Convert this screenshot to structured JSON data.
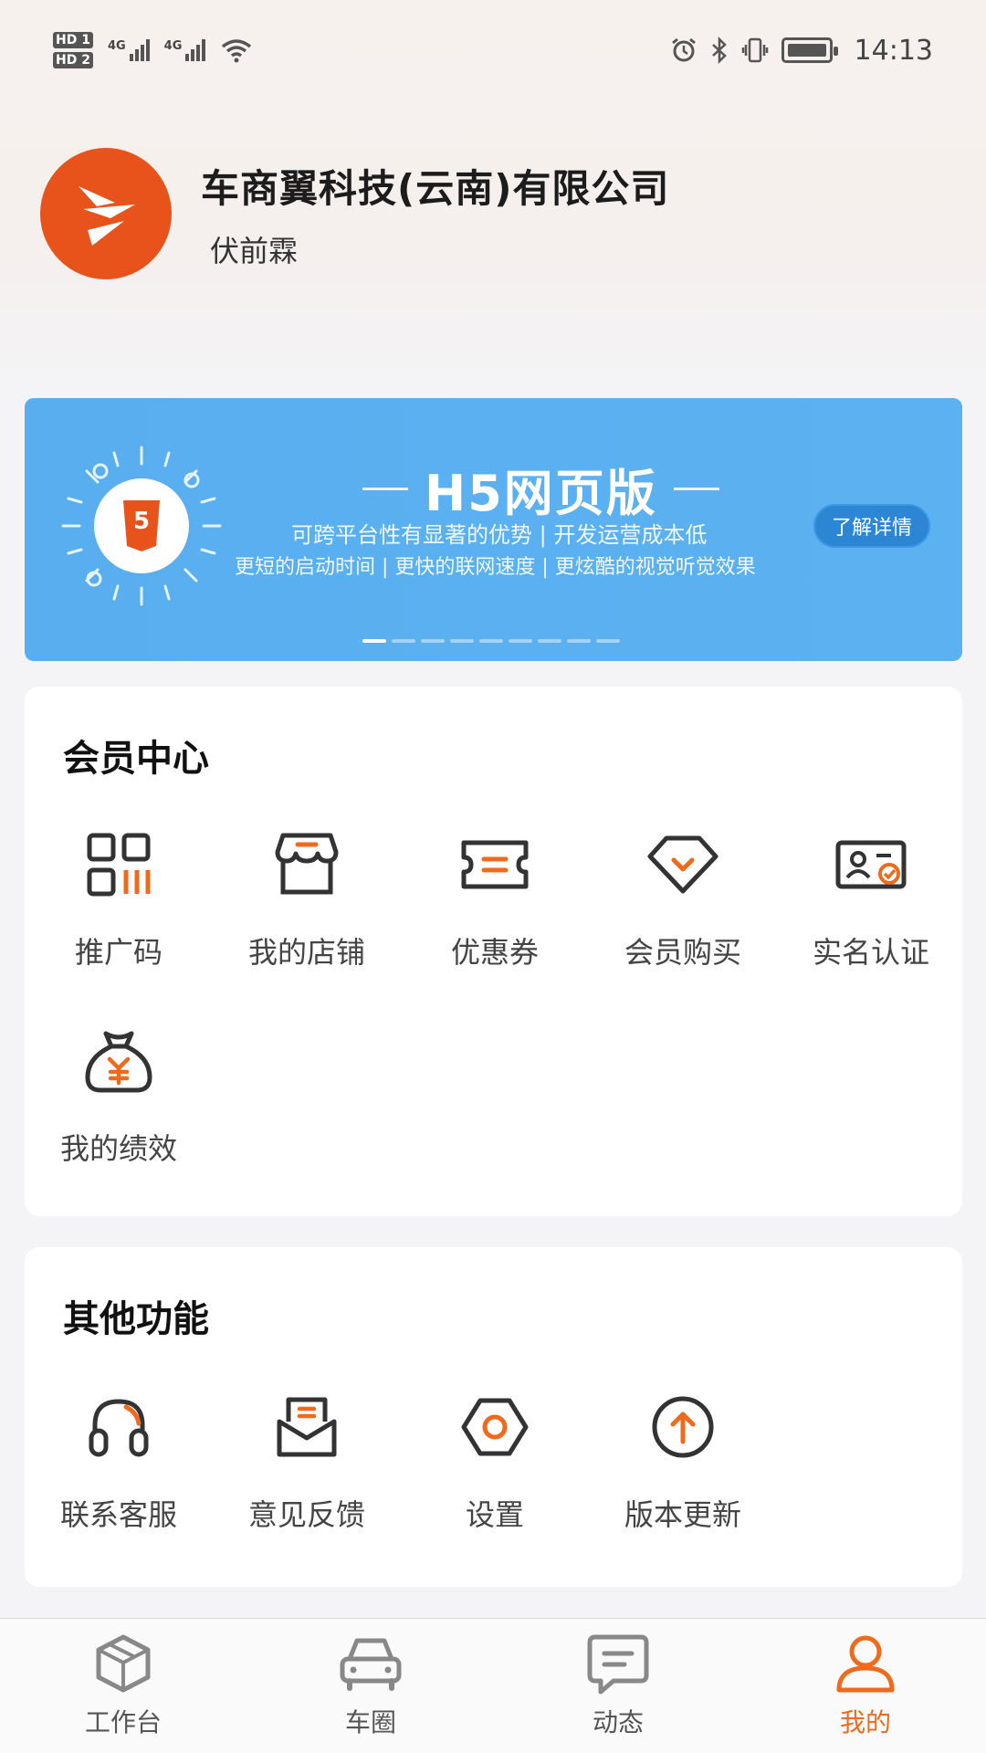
{
  "status_bar": {
    "hd1": "HD 1",
    "hd2": "HD 2",
    "net1": "4G",
    "net2": "4G",
    "time": "14:13"
  },
  "profile": {
    "company": "车商翼科技(云南)有限公司",
    "person": "伏前霖"
  },
  "banner": {
    "title": "H5网页版",
    "line1": "可跨平台性有显著的优势 | 开发运营成本低",
    "line2": "更短的启动时间 | 更快的联网速度 | 更炫酷的视觉听觉效果",
    "button": "了解详情",
    "badge": "5",
    "dots": 9,
    "active_dot": 0
  },
  "member_center": {
    "title": "会员中心",
    "items": [
      {
        "label": "推广码",
        "icon": "qr-code-icon"
      },
      {
        "label": "我的店铺",
        "icon": "shop-icon"
      },
      {
        "label": "优惠券",
        "icon": "coupon-icon"
      },
      {
        "label": "会员购买",
        "icon": "diamond-icon"
      },
      {
        "label": "实名认证",
        "icon": "id-card-icon"
      },
      {
        "label": "我的绩效",
        "icon": "money-bag-icon"
      }
    ]
  },
  "other_functions": {
    "title": "其他功能",
    "items": [
      {
        "label": "联系客服",
        "icon": "headset-icon"
      },
      {
        "label": "意见反馈",
        "icon": "feedback-icon"
      },
      {
        "label": "设置",
        "icon": "settings-icon"
      },
      {
        "label": "版本更新",
        "icon": "update-icon"
      }
    ]
  },
  "bottom_nav": {
    "items": [
      {
        "label": "工作台",
        "icon": "workbench-icon"
      },
      {
        "label": "车圈",
        "icon": "car-icon"
      },
      {
        "label": "动态",
        "icon": "message-icon"
      },
      {
        "label": "我的",
        "icon": "user-icon",
        "active": true
      }
    ]
  },
  "colors": {
    "accent": "#ef6a1c",
    "icon_dark": "#333333",
    "banner_blue": "#5aaff0",
    "logo_orange": "#e8531c"
  }
}
